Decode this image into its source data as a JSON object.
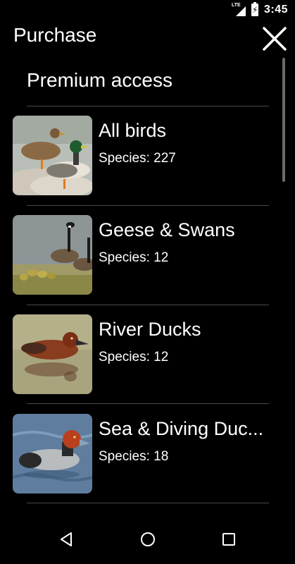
{
  "status": {
    "network": "LTE",
    "time": "3:45"
  },
  "toolbar": {
    "title": "Purchase"
  },
  "section": {
    "header": "Premium access"
  },
  "items": [
    {
      "title": "All birds",
      "subtitle": "Species: 227",
      "image": "mallard-pair-photo"
    },
    {
      "title": "Geese & Swans",
      "subtitle": "Species: 12",
      "image": "canada-geese-with-goslings-photo"
    },
    {
      "title": "River Ducks",
      "subtitle": "Species: 12",
      "image": "ferruginous-duck-photo"
    },
    {
      "title": "Sea & Diving Duc...",
      "subtitle": "Species: 18",
      "image": "redhead-duck-photo"
    }
  ],
  "colors": {
    "background": "#000000",
    "divider": "#4a4a4a",
    "text": "#ffffff"
  }
}
